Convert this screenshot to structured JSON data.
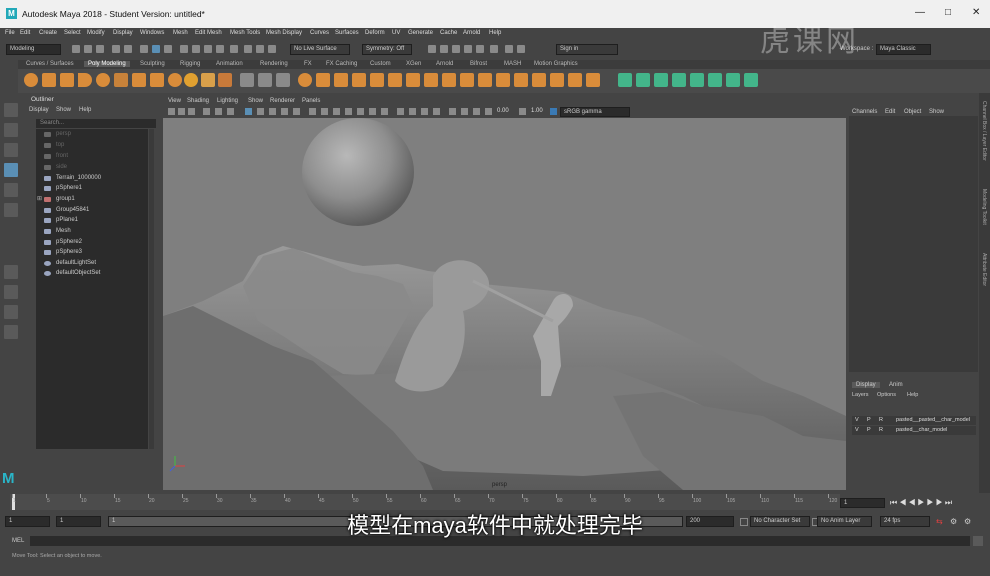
{
  "window": {
    "title": "Autodesk Maya 2018 - Student Version: untitled*",
    "logo": "M",
    "minimize": "—",
    "maximize": "□",
    "close": "✕"
  },
  "menubar": [
    "File",
    "Edit",
    "Create",
    "Select",
    "Modify",
    "Display",
    "Windows",
    "Mesh",
    "Edit Mesh",
    "Mesh Tools",
    "Mesh Display",
    "Curves",
    "Surfaces",
    "Deform",
    "UV",
    "Generate",
    "Cache",
    "Arnold",
    "Help"
  ],
  "statusline": {
    "mode": "Modeling",
    "live": "No Live Surface",
    "symmetry": "Symmetry: Off",
    "signin": "Sign in",
    "workspace": "Workspace :",
    "workspace_value": "Maya Classic"
  },
  "shelf_tabs": [
    "Curves / Surfaces",
    "Poly Modeling",
    "Sculpting",
    "Rigging",
    "Animation",
    "Rendering",
    "FX",
    "FX Caching",
    "Custom",
    "XGen",
    "Arnold",
    "Bifrost",
    "MASH",
    "Motion Graphics"
  ],
  "shelf_active": "Poly Modeling",
  "outliner": {
    "title": "Outliner",
    "menu": [
      "Display",
      "Show",
      "Help"
    ],
    "search_placeholder": "Search...",
    "items": [
      {
        "label": "persp",
        "dim": true
      },
      {
        "label": "top",
        "dim": true
      },
      {
        "label": "front",
        "dim": true
      },
      {
        "label": "side",
        "dim": true
      },
      {
        "label": "Terrain_1000000",
        "dim": false
      },
      {
        "label": "pSphere1",
        "dim": false
      },
      {
        "label": "group1",
        "dim": false
      },
      {
        "label": "Group45841",
        "dim": false
      },
      {
        "label": "pPlane1",
        "dim": false
      },
      {
        "label": "Mesh",
        "dim": false
      },
      {
        "label": "pSphere2",
        "dim": false
      },
      {
        "label": "pSphere3",
        "dim": false
      },
      {
        "label": "defaultLightSet",
        "dim": false
      },
      {
        "label": "defaultObjectSet",
        "dim": false
      }
    ]
  },
  "viewport": {
    "menu": [
      "View",
      "Shading",
      "Lighting",
      "Show",
      "Renderer",
      "Panels"
    ],
    "camera": "persp",
    "exposure": "0.00",
    "gamma": "1.00",
    "colorspace": "sRGB gamma"
  },
  "channelbox": {
    "menu": [
      "Channels",
      "Edit",
      "Object",
      "Show"
    ]
  },
  "layers": {
    "tabs": [
      "Display",
      "Anim"
    ],
    "menu": [
      "Layers",
      "Options",
      "Help"
    ],
    "rows": [
      {
        "v": "V",
        "p": "P",
        "r": "R",
        "name": "pasted__pasted__char_model"
      },
      {
        "v": "V",
        "p": "P",
        "r": "R",
        "name": "pasted__char_model"
      }
    ]
  },
  "side_tabs": [
    "Channel Box / Layer Editor",
    "Modeling Toolkit",
    "Attribute Editor"
  ],
  "timeline": {
    "ticks": [
      "1",
      "5",
      "10",
      "15",
      "20",
      "25",
      "30",
      "35",
      "40",
      "45",
      "50",
      "55",
      "60",
      "65",
      "70",
      "75",
      "80",
      "85",
      "90",
      "95",
      "100",
      "105",
      "110",
      "115",
      "120"
    ],
    "current": "1"
  },
  "range": {
    "start": "1",
    "start2": "1",
    "range_label": "1",
    "end": "200",
    "no_char": "No Character Set",
    "no_anim": "No Anim Layer",
    "fps": "24 fps"
  },
  "cmdline": {
    "label": "MEL",
    "help": "Move Tool: Select an object to move."
  },
  "subtitle": "模型在maya软件中就处理完毕",
  "watermark": "虎课网",
  "colors": {
    "accent": "#22a8b8",
    "shelf_orange": "#d98c3a",
    "shelf_green": "#43b58a"
  }
}
